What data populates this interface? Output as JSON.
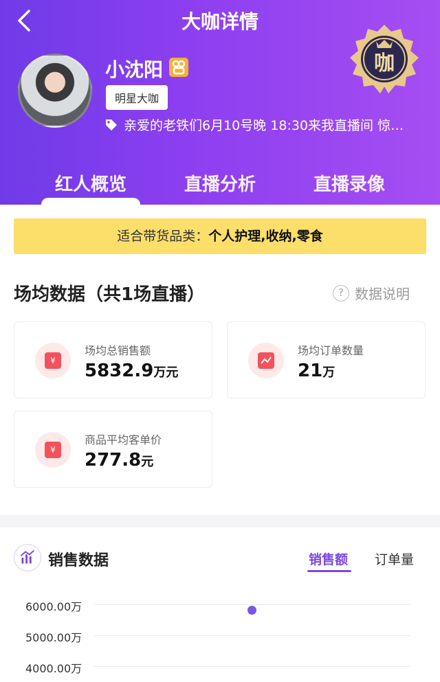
{
  "header": {
    "title": "大咖详情",
    "name": "小沈阳",
    "tag": "明星大咖",
    "notice": "亲爱的老铁们6月10号晚 18:30来我直播间 惊…",
    "seal_text": "咖"
  },
  "tabs": [
    {
      "label": "红人概览",
      "active": true
    },
    {
      "label": "直播分析",
      "active": false
    },
    {
      "label": "直播录像",
      "active": false
    }
  ],
  "category": {
    "prefix": "适合带货品类：",
    "value": "个人护理,收纳,零食"
  },
  "summary": {
    "title": "场均数据（共1场直播）",
    "help": "数据说明",
    "cards": [
      {
        "label": "场均总销售额",
        "value": "5832.9",
        "unit": "万元",
        "icon": "money-bag-icon"
      },
      {
        "label": "场均订单数量",
        "value": "21",
        "unit": "万",
        "icon": "order-chart-icon"
      },
      {
        "label": "商品平均客单价",
        "value": "277.8",
        "unit": "元",
        "icon": "ticket-icon"
      }
    ]
  },
  "sales": {
    "title": "销售数据",
    "tabs": [
      "销售额",
      "订单量"
    ],
    "active_tab": "销售额"
  },
  "chart_data": {
    "type": "scatter",
    "y_ticks": [
      "6000.00万",
      "5000.00万",
      "4000.00万"
    ],
    "x": [
      1
    ],
    "values": [
      5832.9
    ],
    "ylim": [
      4000,
      6000
    ]
  },
  "colors": {
    "primary": "#7b47e0",
    "accent_yellow": "#fcde6a",
    "icon_red": "#f3525c"
  }
}
